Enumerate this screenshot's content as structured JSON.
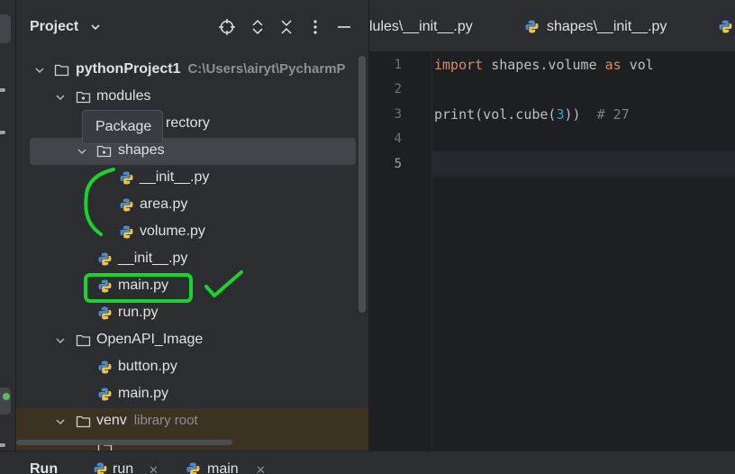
{
  "toolstrip": {},
  "project_panel": {
    "title": "Project",
    "header_icons": [
      "locate-icon",
      "expand-collapse-icon",
      "collapse-all-icon",
      "more-options-icon",
      "minimize-icon"
    ],
    "tree": [
      {
        "label": "pythonProject1",
        "hint": "C:\\Users\\airyt\\PycharmP",
        "type": "folder"
      },
      {
        "label": "modules",
        "type": "package"
      },
      {
        "label": "rectory",
        "type": "text"
      },
      {
        "label": "shapes",
        "type": "package"
      },
      {
        "label": "__init__.py",
        "type": "python"
      },
      {
        "label": "area.py",
        "type": "python"
      },
      {
        "label": "volume.py",
        "type": "python"
      },
      {
        "label": "__init__.py",
        "type": "python"
      },
      {
        "label": "main.py",
        "type": "python"
      },
      {
        "label": "run.py",
        "type": "python"
      },
      {
        "label": "OpenAPI_Image",
        "type": "folder"
      },
      {
        "label": "button.py",
        "type": "python"
      },
      {
        "label": "main.py",
        "type": "python"
      },
      {
        "label": "venv",
        "hint": "library root",
        "type": "folder"
      }
    ],
    "tooltip": "Package"
  },
  "editor": {
    "tabs": [
      {
        "label": "lules\\__init__.py"
      },
      {
        "label": "shapes\\__init__.py"
      }
    ],
    "line_numbers": [
      "1",
      "2",
      "3",
      "4",
      "5"
    ],
    "code": {
      "line1_kw1": "import",
      "line1_mid": " shapes.volume ",
      "line1_kw2": "as",
      "line1_end": " vol",
      "line3_fn": "print(vol.cube(",
      "line3_num": "3",
      "line3_close": "))",
      "line3_comment": "  # 27"
    }
  },
  "bottom_bar": {
    "run_label": "Run",
    "tabs": [
      {
        "label": "run"
      },
      {
        "label": "main"
      }
    ]
  },
  "colors": {
    "annotation_green": "#19d42a",
    "keyword": "#cf8e6d",
    "number": "#2aacb8",
    "comment": "#7a7e85"
  }
}
